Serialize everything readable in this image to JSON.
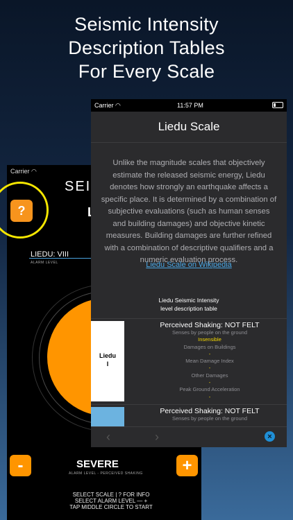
{
  "headline": [
    "Seismic Intensity",
    "Description Tables",
    "For Every Scale"
  ],
  "back_phone": {
    "status_carrier": "Carrier",
    "title": "SEISMI",
    "subtitle": "L",
    "help_label": "?",
    "liedu_reading": "LIEDU: VIII",
    "alarm_level_label": "ALARM LEVEL",
    "minus_label": "-",
    "plus_label": "+",
    "severity": "SEVERE",
    "severity_sub": "ALARM LEVEL - PERCEIVED SHAKING",
    "instructions": [
      "SELECT SCALE | ? FOR INFO",
      "SELECT ALARM LEVEL — +",
      "TAP MIDDLE CIRCLE TO START"
    ]
  },
  "front_phone": {
    "status_carrier": "Carrier",
    "status_time": "11:57 PM",
    "nav_title": "Liedu Scale",
    "description": "Unlike the magnitude scales that objectively estimate the released seismic energy, Liedu denotes how strongly an earthquake affects a specific place. It is determined by a combination of subjective evaluations (such as human senses and building damages) and objective kinetic measures. Building damages are further refined with a combination of descriptive qualifiers and a numeric evaluation process.",
    "wiki_link": "Liedu Scale on Wikipedia",
    "table_heading": [
      "Liedu Seismic Intensity",
      "level description table"
    ],
    "rows": [
      {
        "code": [
          "Liedu",
          "I"
        ],
        "title": "Perceived Shaking: NOT FELT",
        "lines": [
          {
            "text": "Senses by people on the ground",
            "style": "small"
          },
          {
            "text": "Insensible",
            "style": "yellow"
          },
          {
            "text": "Damages on Buildings",
            "style": "small"
          },
          {
            "text": "-",
            "style": "yellow"
          },
          {
            "text": "Mean Damage Index",
            "style": "small"
          },
          {
            "text": "-",
            "style": "yellow"
          },
          {
            "text": "Other Damages",
            "style": "small"
          },
          {
            "text": "-",
            "style": "yellow"
          },
          {
            "text": "Peak Ground Acceleration",
            "style": "small"
          },
          {
            "text": "-",
            "style": "yellow"
          }
        ]
      },
      {
        "title": "Perceived Shaking: NOT FELT",
        "lines": [
          {
            "text": "Senses by people on the ground",
            "style": "small"
          }
        ]
      }
    ],
    "toolbar": {
      "back": "‹",
      "forward": "›",
      "close": "×"
    }
  },
  "colors": {
    "accent_orange": "#ff9500",
    "highlight_yellow": "#f5e600",
    "link_blue": "#4aa8e6"
  }
}
